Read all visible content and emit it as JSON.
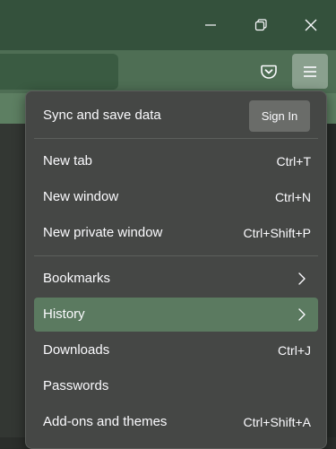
{
  "window_controls": {
    "minimize_icon": "minimize-icon",
    "restore_icon": "restore-icon",
    "close_icon": "close-icon"
  },
  "toolbar": {
    "pocket_icon": "pocket-icon",
    "menu_icon": "hamburger-menu-icon"
  },
  "panel": {
    "sync_label": "Sync and save data",
    "signin_label": "Sign In",
    "groups": [
      [
        {
          "label": "New tab",
          "shortcut": "Ctrl+T"
        },
        {
          "label": "New window",
          "shortcut": "Ctrl+N"
        },
        {
          "label": "New private window",
          "shortcut": "Ctrl+Shift+P"
        }
      ],
      [
        {
          "label": "Bookmarks",
          "icon": "chevron-right-icon"
        },
        {
          "label": "History",
          "icon": "chevron-right-icon",
          "highlighted": true
        },
        {
          "label": "Downloads",
          "shortcut": "Ctrl+J"
        },
        {
          "label": "Passwords"
        },
        {
          "label": "Add-ons and themes",
          "shortcut": "Ctrl+Shift+A"
        }
      ]
    ]
  },
  "colors": {
    "titlebar": "#34513c",
    "navbar": "#4e6e54",
    "menu_button": "#8aa08e",
    "panel_bg": "#454745",
    "highlight": "#5b7a60",
    "text": "#fbfbfe"
  }
}
